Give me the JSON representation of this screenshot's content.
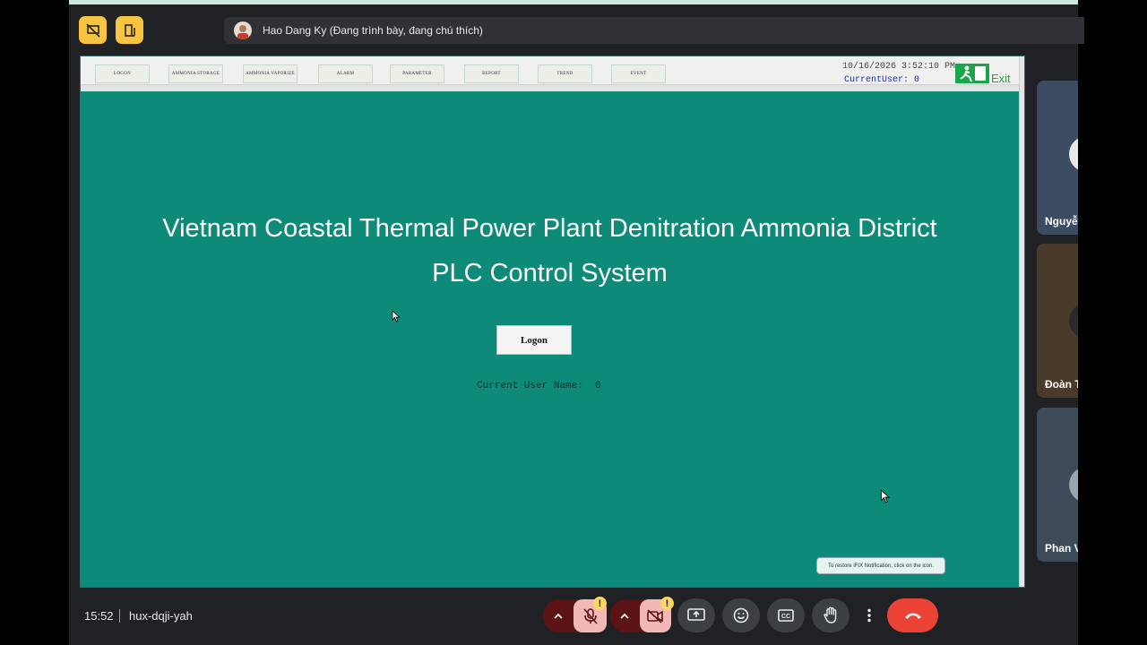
{
  "meet": {
    "presenter_name": "Hao Dang Ky (Đang trình bày, đang chú thích)",
    "time": "15:52",
    "meeting_code": "hux-dqji-yah",
    "participants": [
      {
        "name": "Nguyễ"
      },
      {
        "name": "Đoàn T"
      },
      {
        "name": "Phan V"
      }
    ],
    "warning_badge": "!",
    "colors": {
      "background": "#202124",
      "accent_yellow": "#f9c440",
      "end_call": "#ea4335",
      "muted_red": "#f2b8b5"
    }
  },
  "hmi": {
    "nav_buttons": [
      "LOGON",
      "AMMONIA STORAGE",
      "AMMONIA VAPORIZE",
      "ALARM",
      "PARAMETER",
      "REPORT",
      "TREND",
      "EVENT"
    ],
    "datetime": "10/16/2026 3:52:10 PM",
    "current_user_header": "CurrentUser: 0",
    "exit_label": "Exit",
    "title_line1": "Vietnam Coastal Thermal Power Plant Denitration Ammonia District",
    "title_line2": "PLC Control System",
    "logon_button": "Logon",
    "current_user_label": "Current User Name:",
    "current_user_value": "0",
    "notification": "To restore iFIX Notification, click on the icon.",
    "colors": {
      "background": "#0e8a78",
      "title": "#ffffff"
    }
  }
}
